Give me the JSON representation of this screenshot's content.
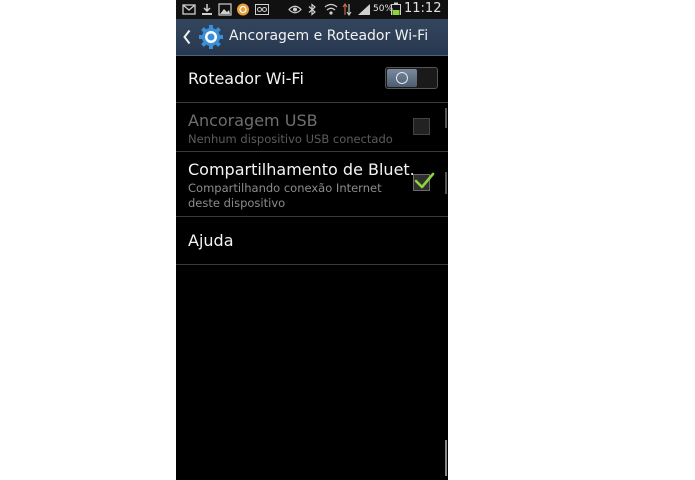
{
  "status_bar": {
    "battery_percent": "50%",
    "time": "11:12"
  },
  "action_bar": {
    "title": "Ancoragem e Roteador Wi-Fi",
    "back_icon": "chevron-left-icon",
    "app_icon": "gear-icon"
  },
  "settings": {
    "wifi_router": {
      "label": "Roteador Wi-Fi",
      "enabled": false
    },
    "usb_tethering": {
      "label": "Ancoragem USB",
      "summary": "Nenhum dispositivo USB conectado",
      "checked": false,
      "disabled": true
    },
    "bluetooth_tethering": {
      "label": "Compartilhamento de Bluet.",
      "summary": "Compartilhando conexão Internet deste dispositivo",
      "checked": true
    },
    "help": {
      "label": "Ajuda"
    }
  },
  "colors": {
    "action_bar": "#2d3f57",
    "background": "#000000",
    "check_accent": "#8bd43a"
  }
}
